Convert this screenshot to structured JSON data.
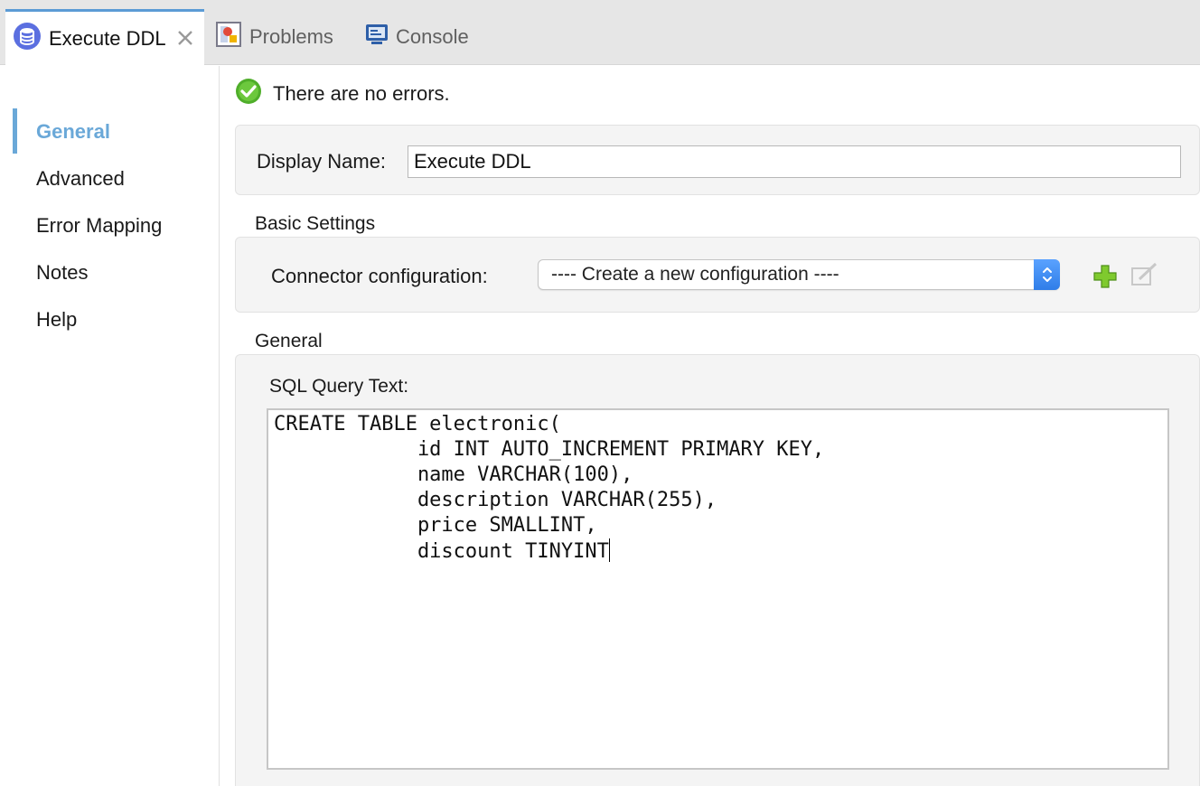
{
  "tabs": [
    {
      "label": "Execute DDL",
      "icon": "database-icon",
      "active": true
    },
    {
      "label": "Problems",
      "icon": "problems-icon",
      "active": false
    },
    {
      "label": "Console",
      "icon": "console-icon",
      "active": false
    }
  ],
  "sidebar": {
    "items": [
      {
        "label": "General",
        "active": true
      },
      {
        "label": "Advanced"
      },
      {
        "label": "Error Mapping"
      },
      {
        "label": "Notes"
      },
      {
        "label": "Help"
      }
    ]
  },
  "status": {
    "text": "There are no errors.",
    "icon": "check-circle-icon"
  },
  "display_name": {
    "label": "Display Name:",
    "value": "Execute DDL"
  },
  "basic_settings": {
    "title": "Basic Settings",
    "connector_label": "Connector configuration:",
    "connector_value": "---- Create a new configuration ----"
  },
  "general": {
    "title": "General",
    "sql_label": "SQL Query Text:",
    "sql_text": "CREATE TABLE electronic(\n            id INT AUTO_INCREMENT PRIMARY KEY,\n            name VARCHAR(100),\n            description VARCHAR(255),\n            price SMALLINT,\n            discount TINYINT"
  },
  "colors": {
    "accent": "#6aa8d8",
    "tab_accent": "#5b9bd5",
    "success": "#5cb82e",
    "add": "#6fbf2a"
  }
}
